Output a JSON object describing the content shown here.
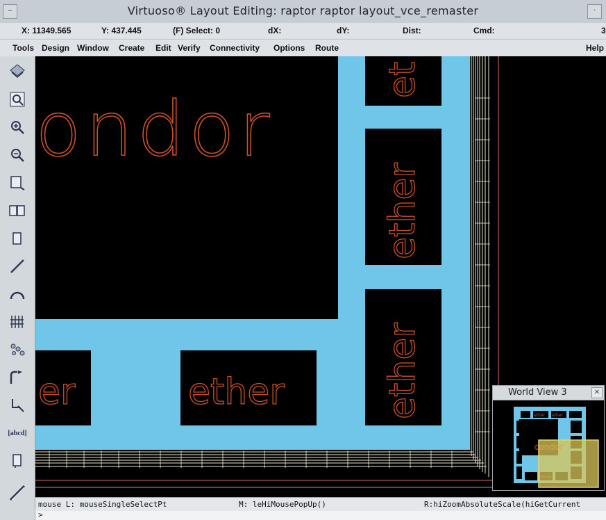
{
  "window": {
    "title": "Virtuoso® Layout Editing: raptor raptor layout_vce_remaster",
    "system_menu_glyph": "–",
    "minimize_glyph": "·"
  },
  "status": {
    "x": "X: 11349.565",
    "y": "Y: 437.445",
    "select": "(F) Select: 0",
    "dx": "dX:",
    "dy": "dY:",
    "dist": "Dist:",
    "cmd": "Cmd:",
    "cut_off": "3"
  },
  "menu": {
    "items": [
      "Tools",
      "Design",
      "Window",
      "Create",
      "Edit",
      "Verify",
      "Connectivity",
      "Options",
      "Route"
    ],
    "help": "Help"
  },
  "toolbar": {
    "icons": [
      "layers-icon",
      "zoom-fit-icon",
      "zoom-in-icon",
      "zoom-out-icon",
      "stretch-icon",
      "copy-icon",
      "rectangle-icon",
      "path-icon",
      "arc-icon",
      "pin-array-icon",
      "instance-icon",
      "wire-icon",
      "select-area-icon",
      "label-icon",
      "properties-icon",
      "ruler-icon"
    ],
    "label_tool_text": "[abcd]"
  },
  "canvas": {
    "colors": {
      "background": "#000000",
      "metal": "#6fc6e8",
      "text_outline": "#c8502a",
      "routing_lines": "#e8e6c9",
      "boundary": "#d86a6a"
    },
    "labels": {
      "big_text": "ondor",
      "ether_top": "et",
      "ether_mid": "ether",
      "ether_low": "ether",
      "bottom_left": "er",
      "bottom_mid": "ether"
    }
  },
  "world_view": {
    "title": "World View 3",
    "close_glyph": "✕",
    "mini_big_text": "condor",
    "mini_ether": "ether",
    "colors": {
      "viewport_highlight": "#d9c75a"
    }
  },
  "mouse_status": {
    "left": "mouse L: mouseSingleSelectPt",
    "middle": "M: leHiMousePopUp()",
    "right": "R:hiZoomAbsoluteScale(hiGetCurrent"
  },
  "command": {
    "prompt": ">"
  }
}
